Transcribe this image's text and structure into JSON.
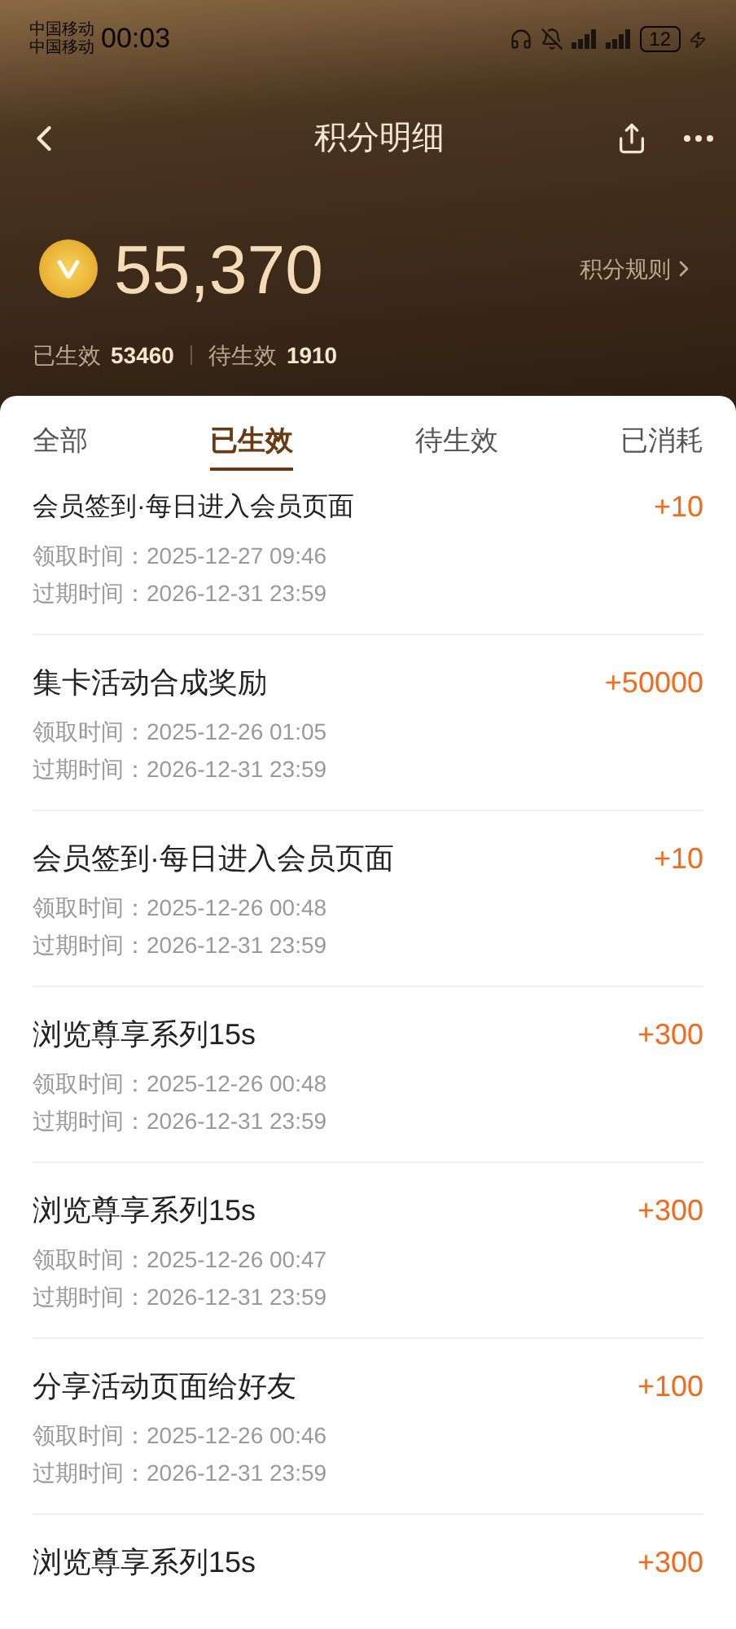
{
  "status_bar": {
    "carriers": [
      "中国移动",
      "中国移动"
    ],
    "time": "00:03",
    "battery": "12"
  },
  "nav": {
    "title": "积分明细"
  },
  "balance": {
    "points": "55,370",
    "rules_link": "积分规则"
  },
  "summary": [
    {
      "label": "已生效",
      "value": "53460"
    },
    {
      "label": "待生效",
      "value": "1910"
    }
  ],
  "tabs": [
    {
      "label": "全部",
      "selected": false
    },
    {
      "label": "已生效",
      "selected": true
    },
    {
      "label": "待生效",
      "selected": false
    },
    {
      "label": "已消耗",
      "selected": false
    }
  ],
  "records": [
    {
      "title": "会员签到·每日进入会员页面",
      "amount": "+10",
      "received": "领取时间：2025-12-27 09:46",
      "expires": "过期时间：2026-12-31 23:59"
    },
    {
      "title": "集卡活动合成奖励",
      "amount": "+50000",
      "received": "领取时间：2025-12-26 01:05",
      "expires": "过期时间：2026-12-31 23:59"
    },
    {
      "title": "会员签到·每日进入会员页面",
      "amount": "+10",
      "received": "领取时间：2025-12-26 00:48",
      "expires": "过期时间：2026-12-31 23:59"
    },
    {
      "title": "浏览尊享系列15s",
      "amount": "+300",
      "received": "领取时间：2025-12-26 00:48",
      "expires": "过期时间：2026-12-31 23:59"
    },
    {
      "title": "浏览尊享系列15s",
      "amount": "+300",
      "received": "领取时间：2025-12-26 00:47",
      "expires": "过期时间：2026-12-31 23:59"
    },
    {
      "title": "分享活动页面给好友",
      "amount": "+100",
      "received": "领取时间：2025-12-26 00:46",
      "expires": "过期时间：2026-12-31 23:59"
    },
    {
      "title": "浏览尊享系列15s",
      "amount": "+300"
    }
  ]
}
